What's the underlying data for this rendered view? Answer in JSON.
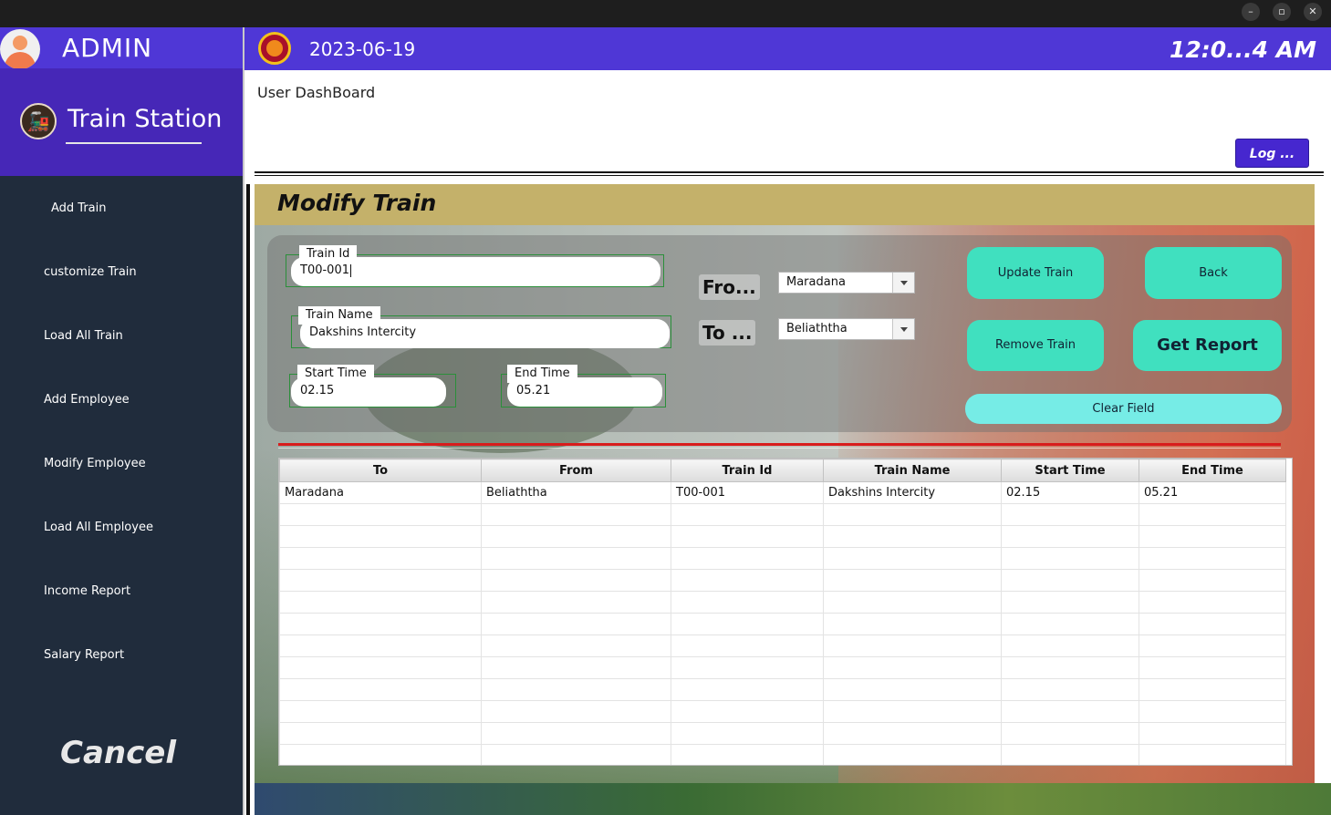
{
  "window": {
    "minimize_icon": "minimize-icon",
    "maximize_icon": "maximize-icon",
    "close_icon": "close-icon"
  },
  "sidebar": {
    "admin_label": "ADMIN",
    "station_title": "Train Station",
    "items": [
      {
        "label": "Add Train"
      },
      {
        "label": "customize Train"
      },
      {
        "label": "Load All Train"
      },
      {
        "label": "Add Employee"
      },
      {
        "label": "Modify Employee"
      },
      {
        "label": "Load All Employee"
      },
      {
        "label": "Income Report"
      },
      {
        "label": "Salary Report"
      }
    ],
    "cancel_label": "Cancel"
  },
  "header": {
    "date": "2023-06-19",
    "time": "12:0...4 AM",
    "dashboard_label": "User DashBoard",
    "log_button": "Log ..."
  },
  "panel": {
    "title": "Modify Train",
    "train_id": {
      "label": "Train Id",
      "value": "T00-001"
    },
    "train_name": {
      "label": "Train Name",
      "value": "Dakshins Intercity"
    },
    "start_time": {
      "label": "Start  Time",
      "value": "02.15"
    },
    "end_time": {
      "label": "End  Time",
      "value": "05.21"
    },
    "from_label": "Fro...",
    "to_label": "To  ...",
    "from_select": "Maradana",
    "to_select": "Beliaththa",
    "buttons": {
      "update": "Update Train",
      "back": "Back",
      "remove": "Remove Train",
      "report": "Get Report",
      "clear": "Clear Field"
    }
  },
  "table": {
    "columns": [
      "To",
      "From",
      "Train Id",
      "Train Name",
      "Start Time",
      "End Time"
    ],
    "rows": [
      [
        "Maradana",
        "Beliaththa",
        "T00-001",
        "Dakshins Intercity",
        "02.15",
        "05.21"
      ]
    ]
  },
  "colors": {
    "accent": "#4f37d6",
    "sidebar": "#202c3c",
    "button": "#40e0bf",
    "header_band": "#c4b16a"
  }
}
